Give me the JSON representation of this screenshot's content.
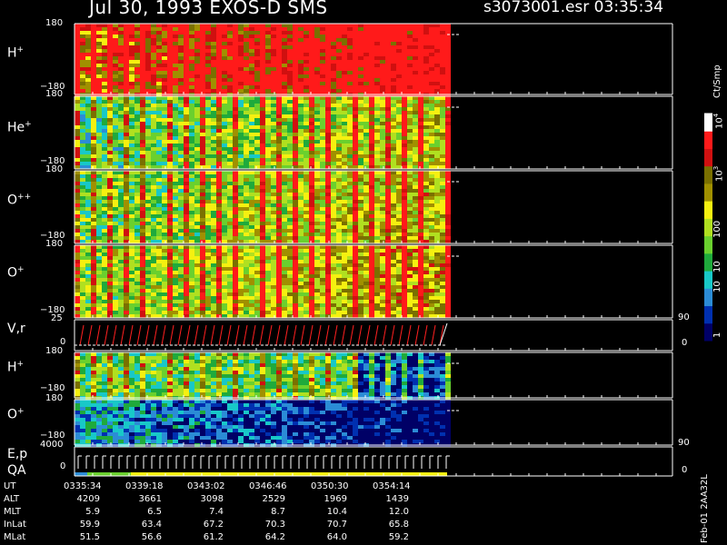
{
  "header": {
    "date_title": "Jul 30, 1993   EXOS-D SMS",
    "file_time": "s3073001.esr  03:35:34"
  },
  "colorbar": {
    "unit_label": "Ct/Smp",
    "top_label": "10",
    "top_exp": "4",
    "ticks": [
      "10",
      "100",
      "10",
      "10",
      "1"
    ],
    "tick_1000_exp": "3",
    "colors": [
      "#000066",
      "#0030b0",
      "#2b8cd6",
      "#18c8c8",
      "#1faa3c",
      "#6ad02e",
      "#b0e020",
      "#f5f010",
      "#a09000",
      "#7a7000",
      "#d01010",
      "#ff1a1a",
      "#ffffff"
    ]
  },
  "panels": [
    {
      "label": "H",
      "sup": "+",
      "ytop": "180",
      "ybot": "−180"
    },
    {
      "label": "He",
      "sup": "+",
      "ytop": "180",
      "ybot": "−180"
    },
    {
      "label": "O",
      "sup": "++",
      "ytop": "180",
      "ybot": "−180"
    },
    {
      "label": "O",
      "sup": "+",
      "ytop": "180",
      "ybot": "−180"
    },
    {
      "label": "V,r",
      "sup": "",
      "ytop": "25",
      "ybot": "0",
      "rtop": "90",
      "rbot": "0"
    },
    {
      "label": "H",
      "sup": "+",
      "ytop": "180",
      "ybot": "−180"
    },
    {
      "label": "O",
      "sup": "+",
      "ytop": "180",
      "ybot": "−180"
    },
    {
      "label": "E,p",
      "label2": "QA",
      "sup": "",
      "ytop": "4000",
      "ybot": "0",
      "rtop": "90",
      "rbot": "0"
    }
  ],
  "ephemeris": {
    "rows": [
      {
        "label": "UT",
        "values": [
          "0335:34",
          "0339:18",
          "0343:02",
          "0346:46",
          "0350:30",
          "0354:14"
        ]
      },
      {
        "label": "ALT",
        "values": [
          "4209",
          "3661",
          "3098",
          "2529",
          "1969",
          "1439"
        ]
      },
      {
        "label": "MLT",
        "values": [
          "5.9",
          "6.5",
          "7.4",
          "8.7",
          "10.4",
          "12.0"
        ]
      },
      {
        "label": "InLat",
        "values": [
          "59.9",
          "63.4",
          "67.2",
          "70.3",
          "70.7",
          "65.8"
        ]
      },
      {
        "label": "MLat",
        "values": [
          "51.5",
          "56.6",
          "61.2",
          "64.2",
          "64.0",
          "59.2"
        ]
      }
    ]
  },
  "footer_vertical": "Feb-01 2AA32L",
  "chart_data": {
    "type": "heatmap",
    "title": "Jul 30, 1993   EXOS-D SMS",
    "x_ticks_ut": [
      "0335:34",
      "0339:18",
      "0343:02",
      "0346:46",
      "0350:30",
      "0354:14"
    ],
    "panels": [
      "H+",
      "He+",
      "O++",
      "O+",
      "V,r",
      "H+",
      "O+",
      "E,p QA"
    ],
    "y_range_angle": [
      -180,
      180
    ],
    "colorbar_range": [
      1,
      10000
    ],
    "colorbar_unit": "Ct/Smp",
    "colorbar_scale": "log"
  }
}
